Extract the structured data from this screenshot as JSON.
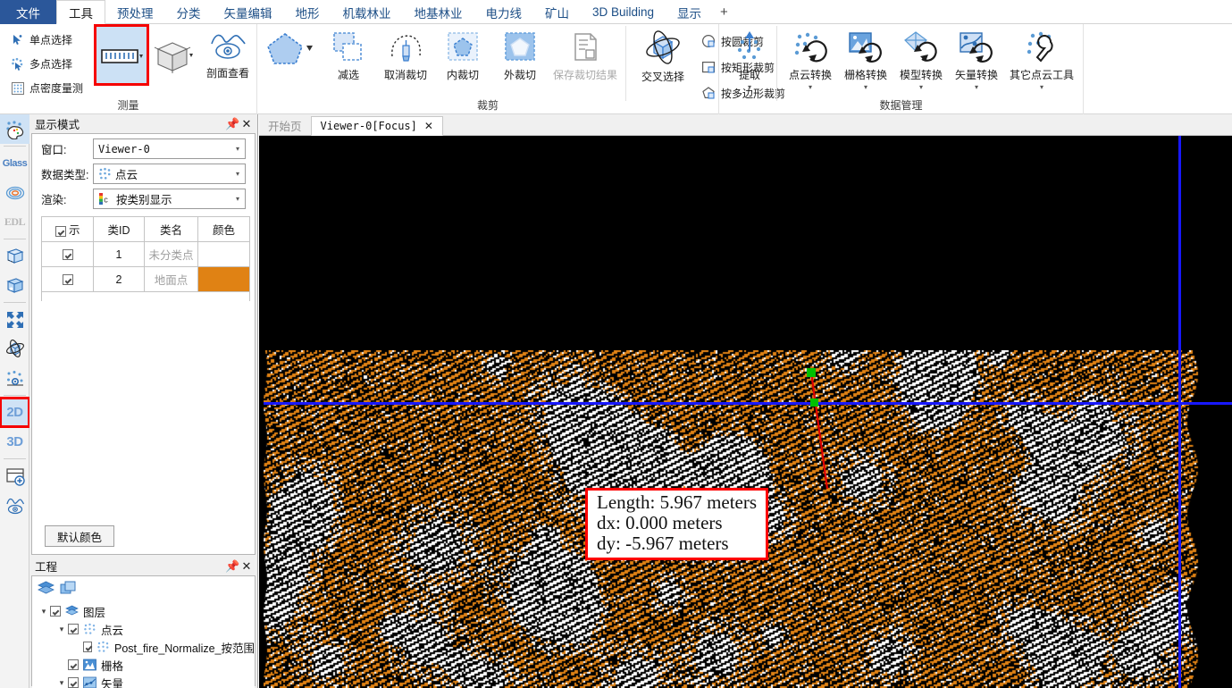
{
  "ribbon_tabs": [
    {
      "label": "文件",
      "state": "file"
    },
    {
      "label": "工具",
      "state": "active"
    },
    {
      "label": "预处理",
      "state": "normal"
    },
    {
      "label": "分类",
      "state": "normal"
    },
    {
      "label": "矢量编辑",
      "state": "normal"
    },
    {
      "label": "地形",
      "state": "normal"
    },
    {
      "label": "机载林业",
      "state": "normal"
    },
    {
      "label": "地基林业",
      "state": "normal"
    },
    {
      "label": "电力线",
      "state": "normal"
    },
    {
      "label": "矿山",
      "state": "normal"
    },
    {
      "label": "3D Building",
      "state": "normal"
    },
    {
      "label": "显示",
      "state": "normal"
    },
    {
      "label": "+",
      "state": "plus"
    }
  ],
  "ribbon_groups": {
    "measure": {
      "label": "测量",
      "small_items": [
        {
          "label": "单点选择",
          "icon": "single-point-select-icon"
        },
        {
          "label": "多点选择",
          "icon": "multi-point-select-icon"
        },
        {
          "label": "点密度量测",
          "icon": "point-density-icon"
        }
      ],
      "big_items": [
        {
          "label": "",
          "icon": "ruler-icon",
          "selected": true,
          "highlighted": true
        },
        {
          "label": "",
          "icon": "box-icon",
          "selected": false
        },
        {
          "label": "剖面查看",
          "icon": "profile-view-icon",
          "selected": false
        }
      ]
    },
    "clip": {
      "label": "裁剪",
      "big_items": [
        {
          "label": "",
          "icon": "polygon-select-icon",
          "disabled": false
        },
        {
          "label": "减选",
          "icon": "subtract-select-icon",
          "disabled": false
        },
        {
          "label": "取消裁切",
          "icon": "cancel-clip-icon",
          "disabled": false
        },
        {
          "label": "内裁切",
          "icon": "inner-clip-icon",
          "disabled": false
        },
        {
          "label": "外裁切",
          "icon": "outer-clip-icon",
          "disabled": false
        },
        {
          "label": "保存裁切结果",
          "icon": "save-clip-result-icon",
          "disabled": true
        }
      ],
      "cross_select": {
        "label": "交叉选择",
        "icon": "cross-select-icon"
      },
      "small_items": [
        {
          "label": "按圆裁剪",
          "icon": "circle-clip-icon"
        },
        {
          "label": "按矩形裁剪",
          "icon": "rect-clip-icon"
        },
        {
          "label": "按多边形裁剪",
          "icon": "polygon-clip-icon"
        }
      ]
    },
    "data_management": {
      "label": "数据管理",
      "big_items": [
        {
          "label": "提取",
          "icon": "extract-icon",
          "caret": true
        },
        {
          "label": "点云转换",
          "icon": "pointcloud-convert-icon",
          "caret": true
        },
        {
          "label": "栅格转换",
          "icon": "raster-convert-icon",
          "caret": true
        },
        {
          "label": "模型转换",
          "icon": "model-convert-icon",
          "caret": true
        },
        {
          "label": "矢量转换",
          "icon": "vector-convert-icon",
          "caret": true
        },
        {
          "label": "其它点云工具",
          "icon": "other-pointcloud-tools-icon",
          "caret": true
        }
      ]
    }
  },
  "vertical_toolbar": [
    {
      "name": "color-palette-icon",
      "kind": "icon",
      "selected": true
    },
    {
      "name": "glass-label",
      "kind": "text",
      "text": "Glass",
      "selected": false
    },
    {
      "name": "contour-icon",
      "kind": "icon",
      "selected": false
    },
    {
      "name": "edl-label",
      "kind": "text",
      "text": "EDL",
      "selected": false
    },
    {
      "name": "bbox-icon",
      "kind": "icon",
      "selected": false
    },
    {
      "name": "bbox-add-icon",
      "kind": "icon",
      "selected": false
    },
    {
      "name": "fit-view-icon",
      "kind": "icon",
      "selected": false
    },
    {
      "name": "orbit-icon",
      "kind": "icon",
      "selected": false
    },
    {
      "name": "point-settings-icon",
      "kind": "icon",
      "selected": false
    },
    {
      "name": "view-2d-label",
      "kind": "text",
      "text": "2D",
      "selected": true,
      "highlighted": true
    },
    {
      "name": "view-3d-label",
      "kind": "text",
      "text": "3D",
      "selected": false
    },
    {
      "name": "add-window-icon",
      "kind": "icon",
      "selected": false
    },
    {
      "name": "profile-eye-icon",
      "kind": "icon",
      "selected": false
    }
  ],
  "display_panel": {
    "title": "显示模式",
    "pin_icon": "pin-icon",
    "close_icon": "close-icon",
    "fields": [
      {
        "label": "窗口:",
        "value": "Viewer-0",
        "icon": null,
        "mono": true
      },
      {
        "label": "数据类型:",
        "value": "点云",
        "icon": "pointcloud-icon",
        "mono": false
      },
      {
        "label": "渲染:",
        "value": "按类别显示",
        "icon": "class-color-icon",
        "mono": false
      }
    ],
    "table": {
      "headers": [
        "示",
        "类ID",
        "类名",
        "颜色"
      ],
      "header_checkbox": true,
      "rows": [
        {
          "checked": true,
          "id": "1",
          "name": "未分类点",
          "color": ""
        },
        {
          "checked": true,
          "id": "2",
          "name": "地面点",
          "color": "#e08214"
        }
      ]
    },
    "default_color_button": "默认颜色"
  },
  "project_panel": {
    "title": "工程",
    "pin_icon": "pin-icon",
    "close_icon": "close-icon",
    "toolbar_icons": [
      "layers-icon",
      "copy-layers-icon"
    ],
    "tree": [
      {
        "depth": 0,
        "expander": "v",
        "checked": true,
        "icon": "layers-icon",
        "label": "图层"
      },
      {
        "depth": 1,
        "expander": "v",
        "checked": true,
        "icon": "pointcloud-icon",
        "label": "点云"
      },
      {
        "depth": 2,
        "expander": "",
        "checked": true,
        "icon": "pointcloud-icon",
        "label": "Post_fire_Normalize_按范围"
      },
      {
        "depth": 1,
        "expander": "",
        "checked": true,
        "icon": "raster-icon",
        "label": "栅格"
      },
      {
        "depth": 1,
        "expander": "v",
        "checked": true,
        "icon": "vector-icon",
        "label": "矢量"
      }
    ]
  },
  "viewer": {
    "tabs": [
      {
        "label": "开始页",
        "active": false,
        "closable": false
      },
      {
        "label": "Viewer-0[Focus]",
        "active": true,
        "closable": true
      }
    ],
    "measurement_tooltip": {
      "lines": [
        "Length: 5.967 meters",
        "dx: 0.000 meters",
        "dy: -5.967 meters"
      ]
    },
    "colors": {
      "background": "#000000",
      "crosshair": "#1818ff",
      "measure_line": "#e00000",
      "measure_node": "#00c000",
      "point_ground": "#e08214",
      "point_unclassified": "#ffffff"
    }
  }
}
